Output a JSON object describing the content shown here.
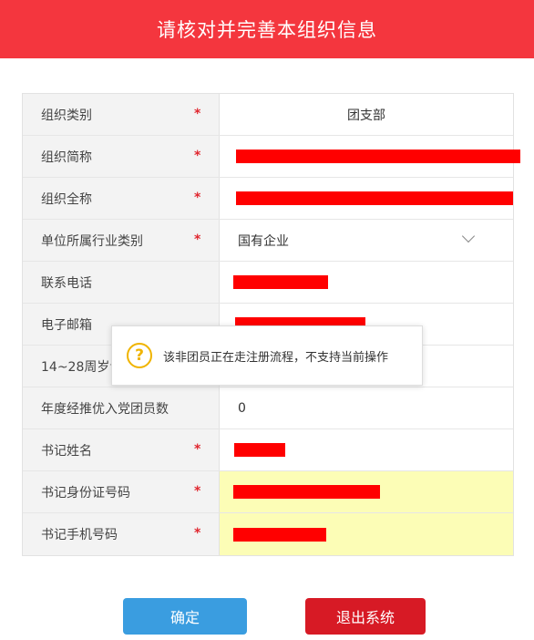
{
  "header": {
    "title": "请核对并完善本组织信息"
  },
  "form": {
    "rows": [
      {
        "label": "组织类别",
        "required": "*",
        "value": "团支部"
      },
      {
        "label": "组织简称",
        "required": "*",
        "value": ""
      },
      {
        "label": "组织全称",
        "required": "*",
        "value": ""
      },
      {
        "label": "单位所属行业类别",
        "required": "*",
        "value": "国有企业"
      },
      {
        "label": "联系电话",
        "required": "",
        "value": ""
      },
      {
        "label": "电子邮箱",
        "required": "",
        "value": ""
      },
      {
        "label": "14~28周岁青",
        "required": "",
        "value": ""
      },
      {
        "label": "年度经推优入党团员数",
        "required": "",
        "value": "0"
      },
      {
        "label": "书记姓名",
        "required": "*",
        "value": ""
      },
      {
        "label": "书记身份证号码",
        "required": "*",
        "value": ""
      },
      {
        "label": "书记手机号码",
        "required": "*",
        "value": ""
      }
    ]
  },
  "dialog": {
    "icon": "question-circle-icon",
    "icon_glyph": "?",
    "message": "该非团员正在走注册流程，不支持当前操作"
  },
  "buttons": {
    "confirm": "确定",
    "exit": "退出系统"
  },
  "colors": {
    "header_bg": "#f4363e",
    "redaction": "#ff0000",
    "confirm_bg": "#3a9de0",
    "exit_bg": "#d71a25",
    "highlight": "#fcfdb6"
  }
}
